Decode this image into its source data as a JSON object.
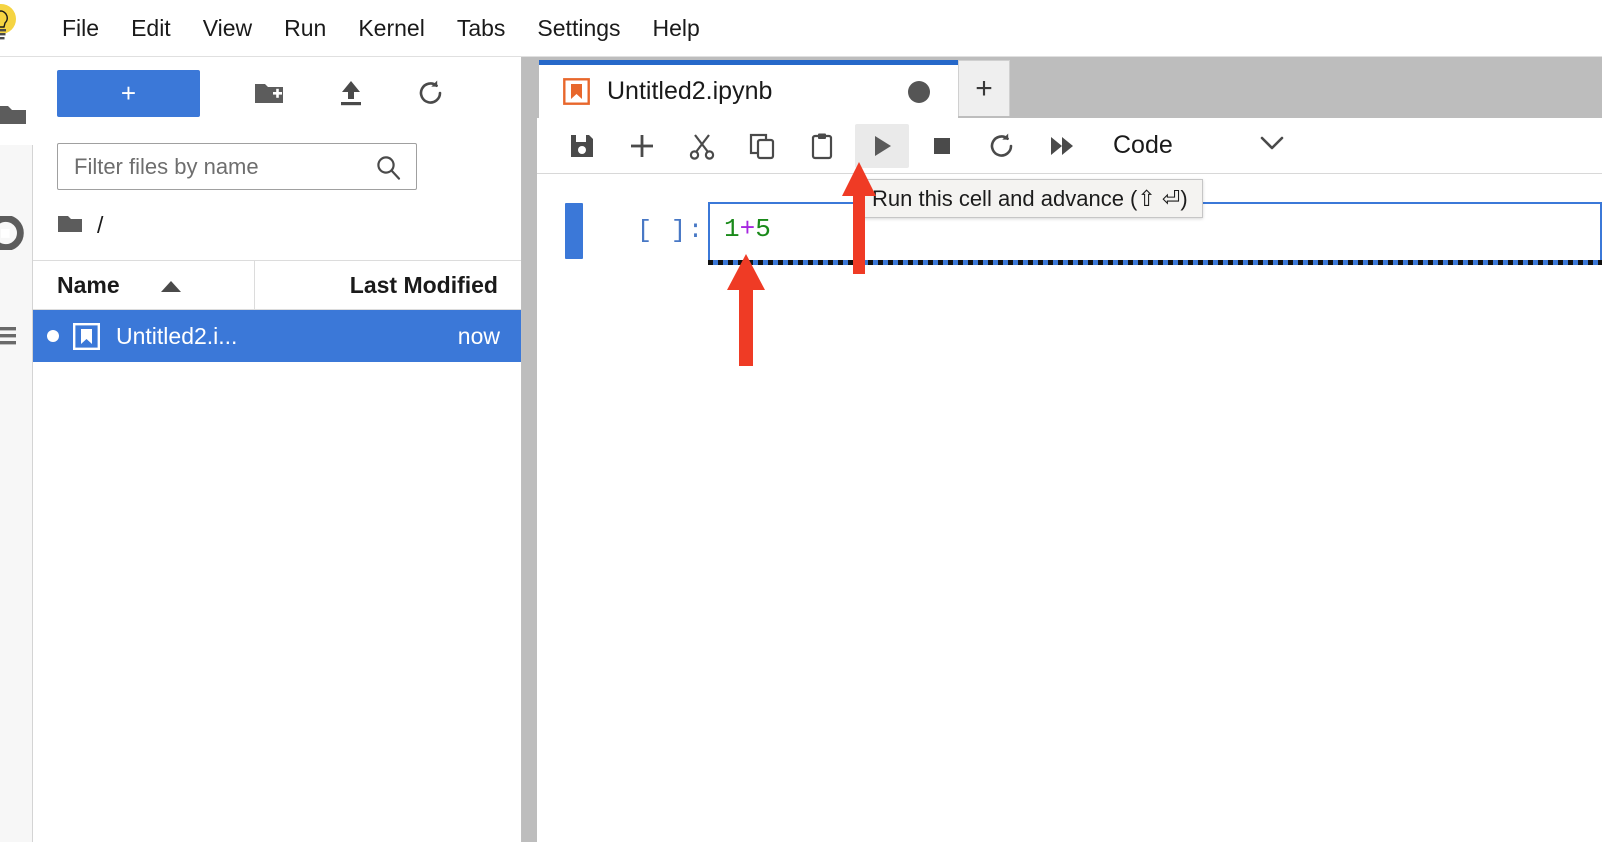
{
  "app": {
    "logo_icon": "jupyter-logo-icon"
  },
  "menubar": {
    "items": [
      {
        "label": "File"
      },
      {
        "label": "Edit"
      },
      {
        "label": "View"
      },
      {
        "label": "Run"
      },
      {
        "label": "Kernel"
      },
      {
        "label": "Tabs"
      },
      {
        "label": "Settings"
      },
      {
        "label": "Help"
      }
    ]
  },
  "sidebar_rail": {
    "items": [
      {
        "name": "file-browser-icon",
        "title": "File Browser"
      },
      {
        "name": "running-kernels-icon",
        "title": "Running Terminals and Kernels"
      },
      {
        "name": "commands-list-icon",
        "title": "Commands"
      }
    ]
  },
  "file_browser": {
    "toolbar": {
      "new_launcher_label": "+",
      "new_folder_icon": "new-folder-icon",
      "upload_icon": "upload-icon",
      "refresh_icon": "refresh-icon"
    },
    "filter": {
      "placeholder": "Filter files by name",
      "value": "",
      "search_icon": "search-icon"
    },
    "breadcrumb": {
      "root_icon": "folder-icon",
      "path": "/"
    },
    "columns": {
      "name": "Name",
      "last_modified": "Last Modified",
      "sort_direction": "ascending"
    },
    "files": [
      {
        "name": "Untitled2.i...",
        "last_modified": "now",
        "icon": "notebook-icon",
        "running": true,
        "selected": true
      }
    ]
  },
  "dock": {
    "tabs": [
      {
        "title": "Untitled2.ipynb",
        "icon": "notebook-icon",
        "dirty": true,
        "active": true
      }
    ],
    "new_tab_label": "+"
  },
  "notebook_toolbar": {
    "buttons": [
      {
        "name": "save-button",
        "icon": "save-icon",
        "title": "Save"
      },
      {
        "name": "insert-cell-button",
        "icon": "plus-icon",
        "title": "Insert a cell below"
      },
      {
        "name": "cut-button",
        "icon": "scissors-icon",
        "title": "Cut"
      },
      {
        "name": "copy-button",
        "icon": "copy-icon",
        "title": "Copy"
      },
      {
        "name": "paste-button",
        "icon": "clipboard-icon",
        "title": "Paste"
      },
      {
        "name": "run-button",
        "icon": "play-icon",
        "title": "Run this cell and advance",
        "hovered": true
      },
      {
        "name": "stop-button",
        "icon": "stop-square-icon",
        "title": "Interrupt the kernel"
      },
      {
        "name": "restart-button",
        "icon": "restart-icon",
        "title": "Restart the kernel"
      },
      {
        "name": "restart-run-all-button",
        "icon": "fast-forward-icon",
        "title": "Restart and run all"
      }
    ],
    "cell_type": {
      "value": "Code",
      "chevron_icon": "chevron-down-icon"
    }
  },
  "tooltip": {
    "text": "Run this cell and advance (⇧ ⏎)"
  },
  "notebook": {
    "cells": [
      {
        "prompt": "[ ]:",
        "code_tokens": [
          {
            "text": "1",
            "type": "number"
          },
          {
            "text": "+",
            "type": "operator"
          },
          {
            "text": "5",
            "type": "number"
          }
        ],
        "active": true
      }
    ]
  },
  "annotations": [
    {
      "name": "arrow-to-code-cell",
      "color": "#ef3b25",
      "direction": "up"
    },
    {
      "name": "arrow-to-run-button",
      "color": "#ef3b25",
      "direction": "up"
    }
  ],
  "colors": {
    "accent_blue": "#3b78d8",
    "tab_active_border": "#2668c9",
    "annotation_red": "#ef3b25",
    "code_number_green": "#1a8a1a",
    "code_operator_purple": "#a626e0",
    "notebook_icon_orange": "#e8672c",
    "tabbar_gray": "#bdbdbd"
  }
}
